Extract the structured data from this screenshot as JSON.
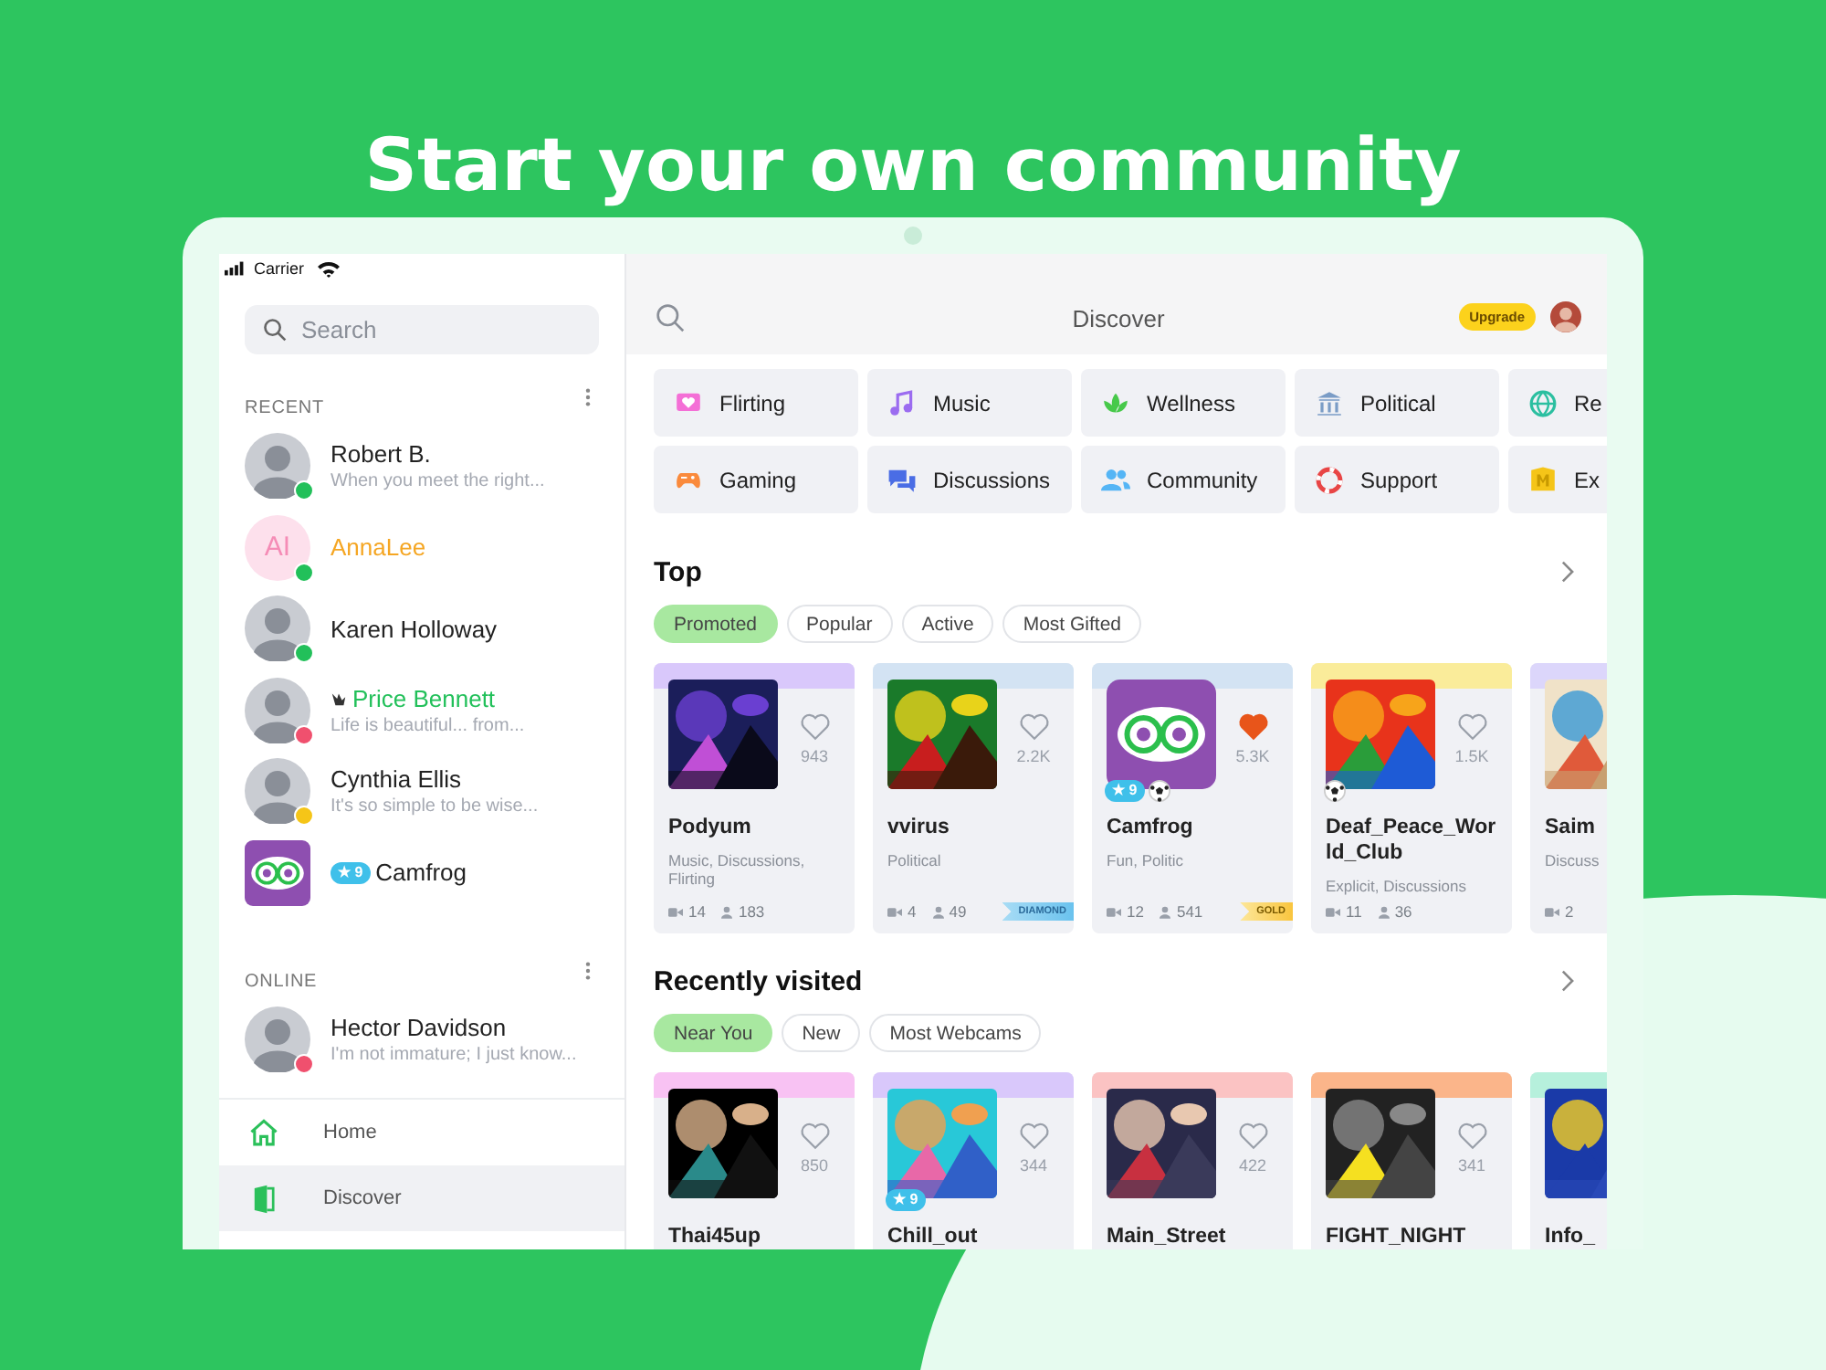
{
  "headline": "Start your own community",
  "status_bar": {
    "carrier": "Carrier"
  },
  "sidebar": {
    "search": {
      "placeholder": "Search"
    },
    "sections": [
      {
        "title": "RECENT",
        "contacts": [
          {
            "name": {
              "text": "Robert B."
            },
            "message": "When you meet the right...",
            "color": "#22c05a"
          },
          {
            "kind": "initials",
            "initials": "AI",
            "name": {
              "text": "AnnaLee",
              "color": "#f5a623"
            },
            "color": "#22c05a"
          },
          {
            "name": {
              "text": "Karen Holloway"
            },
            "color": "#22c05a"
          },
          {
            "name": {
              "text": "Price Bennett",
              "color": "#22c05a"
            },
            "crown": true,
            "message": "Life is beautiful... from...",
            "color": "#f0506e"
          },
          {
            "name": {
              "text": "Cynthia Ellis"
            },
            "message": "It's so simple to be wise...",
            "color": "#f5c518"
          },
          {
            "kind": "room",
            "badge": "★ 9",
            "name": {
              "text": "Camfrog"
            }
          }
        ]
      },
      {
        "title": "ONLINE",
        "contacts": [
          {
            "name": {
              "text": "Hector Davidson"
            },
            "message": "I'm not immature; I just know...",
            "color": "#f0506e"
          }
        ]
      }
    ],
    "nav": [
      {
        "label": "Home",
        "selected": false
      },
      {
        "label": "Discover",
        "selected": true
      }
    ]
  },
  "header": {
    "title": "Discover",
    "upgrade": "Upgrade"
  },
  "categories": [
    {
      "label": "Flirting"
    },
    {
      "label": "Music"
    },
    {
      "label": "Wellness"
    },
    {
      "label": "Political"
    },
    {
      "label": "Re"
    },
    {
      "label": "Gaming"
    },
    {
      "label": "Discussions"
    },
    {
      "label": "Community"
    },
    {
      "label": "Support"
    },
    {
      "label": "Ex"
    }
  ],
  "sections": [
    {
      "title": "Top",
      "chips": [
        {
          "label": "Promoted",
          "selected": true
        },
        {
          "label": "Popular",
          "selected": false
        },
        {
          "label": "Active",
          "selected": false
        },
        {
          "label": "Most Gifted",
          "selected": false
        }
      ],
      "cards": [
        {
          "kind": "picture",
          "name": "Podyum",
          "tags": "Music, Discussions, Flirting",
          "likes": "943",
          "liked": false,
          "cams": "14",
          "users": "183",
          "color": "#d9c8fb"
        },
        {
          "kind": "picture",
          "name": "vvirus",
          "tags": "Political",
          "likes": "2.2K",
          "liked": false,
          "cams": "4",
          "users": "49",
          "tier": "DIAMOND",
          "color": "#d3e3f3"
        },
        {
          "kind": "logo",
          "name": "Camfrog",
          "tags": "Fun, Politic",
          "likes": "5.3K",
          "liked": true,
          "cams": "12",
          "users": "541",
          "tier": "GOLD",
          "badge": "★ 9",
          "ball": true,
          "color": "#d3e3f3"
        },
        {
          "kind": "picture",
          "name": "Deaf_Peace_World_Club",
          "tags": "Explicit, Discussions",
          "likes": "1.5K",
          "liked": false,
          "cams": "11",
          "users": "36",
          "ball": true,
          "color": "#faec9a"
        },
        {
          "kind": "picture",
          "name": "Saim",
          "tags": "Discuss",
          "cams": "2",
          "color": "#dcd6fb"
        }
      ]
    },
    {
      "title": "Recently visited",
      "chips": [
        {
          "label": "Near You",
          "selected": true
        },
        {
          "label": "New",
          "selected": false
        },
        {
          "label": "Most Webcams",
          "selected": false
        }
      ],
      "cards": [
        {
          "kind": "picture",
          "name": "Thai45up",
          "likes": "850",
          "liked": false,
          "color": "#f8c2f3"
        },
        {
          "kind": "picture",
          "name": "Chill_out",
          "likes": "344",
          "liked": false,
          "badge": "★ 9",
          "color": "#d9c8fb"
        },
        {
          "kind": "picture",
          "name": "Main_Street",
          "likes": "422",
          "liked": false,
          "color": "#fbc3c3"
        },
        {
          "kind": "picture",
          "name": "FIGHT_NIGHT",
          "likes": "341",
          "liked": false,
          "color": "#fbb58a"
        },
        {
          "kind": "picture",
          "name": "Info_",
          "color": "#b6f0dc"
        }
      ]
    }
  ]
}
